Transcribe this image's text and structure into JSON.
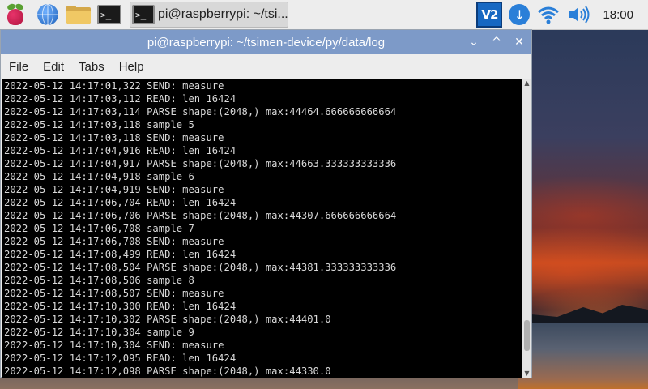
{
  "taskbar": {
    "launchers": [
      {
        "name": "raspberry-pi-menu-icon"
      },
      {
        "name": "web-browser-icon"
      },
      {
        "name": "file-manager-icon"
      },
      {
        "name": "terminal-launcher-icon",
        "glyph": ">_"
      }
    ],
    "task": {
      "label": "pi@raspberrypi: ~/tsi...",
      "glyph": ">_"
    },
    "tray": {
      "vnc_label": "V2",
      "clock": "18:00"
    }
  },
  "window": {
    "title": "pi@raspberrypi: ~/tsimen-device/py/data/log",
    "controls": {
      "minimize": "⌄",
      "maximize": "^",
      "close": "✕"
    },
    "menu": [
      "File",
      "Edit",
      "Tabs",
      "Help"
    ],
    "scrollbar": {
      "position": 0.93,
      "visible_fraction": 0.11
    }
  },
  "terminal": {
    "lines": [
      "2022-05-12 14:17:01,322 SEND: measure",
      "2022-05-12 14:17:03,112 READ: len 16424",
      "2022-05-12 14:17:03,114 PARSE shape:(2048,) max:44464.666666666664",
      "2022-05-12 14:17:03,118 sample 5",
      "2022-05-12 14:17:03,118 SEND: measure",
      "2022-05-12 14:17:04,916 READ: len 16424",
      "2022-05-12 14:17:04,917 PARSE shape:(2048,) max:44663.333333333336",
      "2022-05-12 14:17:04,918 sample 6",
      "2022-05-12 14:17:04,919 SEND: measure",
      "2022-05-12 14:17:06,704 READ: len 16424",
      "2022-05-12 14:17:06,706 PARSE shape:(2048,) max:44307.666666666664",
      "2022-05-12 14:17:06,708 sample 7",
      "2022-05-12 14:17:06,708 SEND: measure",
      "2022-05-12 14:17:08,499 READ: len 16424",
      "2022-05-12 14:17:08,504 PARSE shape:(2048,) max:44381.333333333336",
      "2022-05-12 14:17:08,506 sample 8",
      "2022-05-12 14:17:08,507 SEND: measure",
      "2022-05-12 14:17:10,300 READ: len 16424",
      "2022-05-12 14:17:10,302 PARSE shape:(2048,) max:44401.0",
      "2022-05-12 14:17:10,304 sample 9",
      "2022-05-12 14:17:10,304 SEND: measure",
      "2022-05-12 14:17:12,095 READ: len 16424",
      "2022-05-12 14:17:12,098 PARSE shape:(2048,) max:44330.0"
    ]
  }
}
